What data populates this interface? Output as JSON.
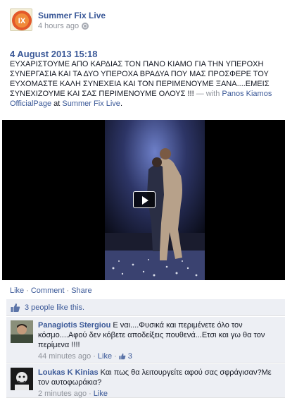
{
  "post": {
    "page_name": "Summer Fix Live",
    "avatar_text": "IX",
    "time_ago": "4 hours ago",
    "date": "4 August 2013 15:18",
    "text": "ΕΥΧΑΡΙΣΤΟΥΜΕ ΑΠΟ ΚΑΡΔΙΑΣ ΤΟΝ ΠΑΝΟ ΚΙΑΜΟ ΓΙΑ ΤΗΝ ΥΠΕΡΟΧΗ ΣΥΝΕΡΓΑΣΙΑ ΚΑΙ ΤΑ ΔΥΟ ΥΠΕΡΟΧΑ ΒΡΑΔΥΑ ΠΟΥ ΜΑΣ ΠΡΟΣΦΕΡΕ ΤΟΥ ΕΥΧΟΜΑΣΤΕ ΚΑΛΗ ΣΥΝΕΧΕΙΑ ΚΑΙ ΤΟΝ ΠΕΡΙΜΕΝΟΥΜΕ ΞΑΝΑ....ΕΜΕΙΣ ΣΥΝΕΧΙΖΟΥΜΕ ΚΑΙ ΣΑΣ ΠΕΡΙΜΕΝΟΥΜΕ ΟΛΟΥΣ !!! ",
    "with_prefix": "— with ",
    "tagged": "Panos Kiamos OfficialPage",
    "at_prefix": " at ",
    "location": "Summer Fix Live",
    "period": "."
  },
  "actions": {
    "like": "Like",
    "comment": "Comment",
    "share": "Share",
    "separator": "·"
  },
  "likes": {
    "text": "3 people like this."
  },
  "comments": [
    {
      "author": "Panagiotis Stergiou",
      "text": "Ε ναι....Φυσικά και περιμένετε όλο τον κόσμο....Αφού δεν κόβετε αποδείξεις πουθενά...Ετσι και γω θα τον περίμενα !!!!",
      "time": "44 minutes ago",
      "like_label": "Like",
      "like_count": "3"
    },
    {
      "author": "Loukas K Kinias",
      "text": "Και πως θα λειτουργείτε αφού σας σφράγισαν?Με τον αυτοφωράκια?",
      "time": "2 minutes ago",
      "like_label": "Like"
    }
  ],
  "colors": {
    "link": "#3b5998",
    "meta": "#90949c",
    "comment_bg": "#edeff4"
  },
  "icons": {
    "globe": "globe-icon",
    "thumb": "thumbs-up-icon",
    "play": "play-icon"
  }
}
